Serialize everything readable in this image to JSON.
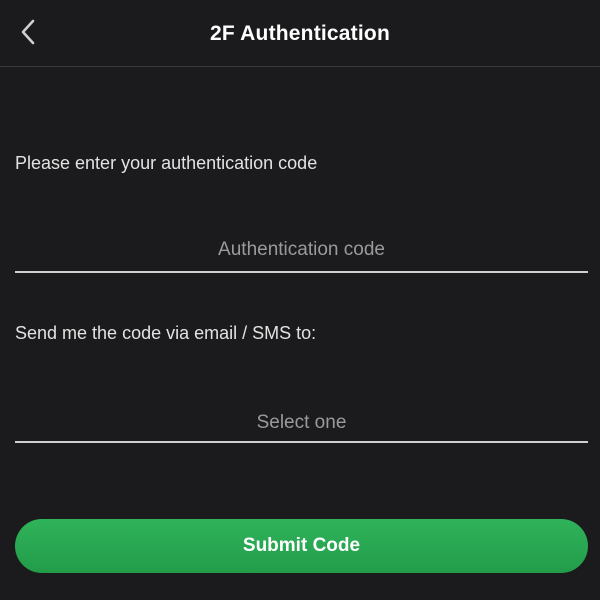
{
  "header": {
    "title": "2F Authentication",
    "back_icon": "chevron-left-icon"
  },
  "form": {
    "code_prompt": "Please enter your authentication code",
    "code_placeholder": "Authentication code",
    "code_value": "",
    "delivery_prompt": "Send me the code via email / SMS to:",
    "delivery_placeholder": "Select one",
    "submit_label": "Submit Code"
  },
  "colors": {
    "background": "#1b1b1d",
    "accent": "#2aa853",
    "divider": "#3a3a3c"
  }
}
